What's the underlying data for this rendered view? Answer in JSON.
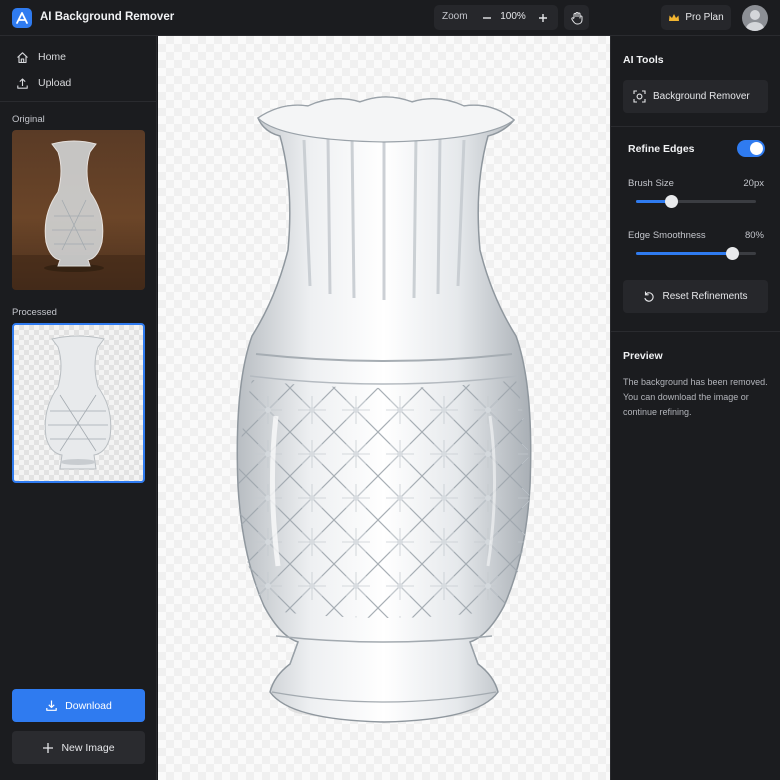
{
  "app": {
    "title": "AI Background Remover"
  },
  "toolbar": {
    "zoom_label": "Zoom",
    "zoom_value": "100%",
    "pro_label": "Pro Plan"
  },
  "sidebar": {
    "nav": [
      {
        "label": "Home",
        "icon": "home-icon"
      },
      {
        "label": "Upload",
        "icon": "upload-icon"
      }
    ],
    "original_label": "Original",
    "processed_label": "Processed",
    "download_label": "Download",
    "new_image_label": "New Image"
  },
  "right_panel": {
    "ai_tools_title": "AI Tools",
    "background_remover_label": "Background Remover",
    "refine_edges_label": "Refine Edges",
    "refine_edges_on": true,
    "brush_size": {
      "label": "Brush Size",
      "value": "20px",
      "fraction": 0.29
    },
    "edge_smoothness": {
      "label": "Edge Smoothness",
      "value": "80%",
      "fraction": 0.8
    },
    "reset_label": "Reset Refinements",
    "preview_title": "Preview",
    "preview_text": "The background has been removed. You can download the image or continue refining."
  },
  "colors": {
    "accent": "#2f7bf0",
    "panel": "#1b1c1f",
    "card": "#26272b"
  }
}
